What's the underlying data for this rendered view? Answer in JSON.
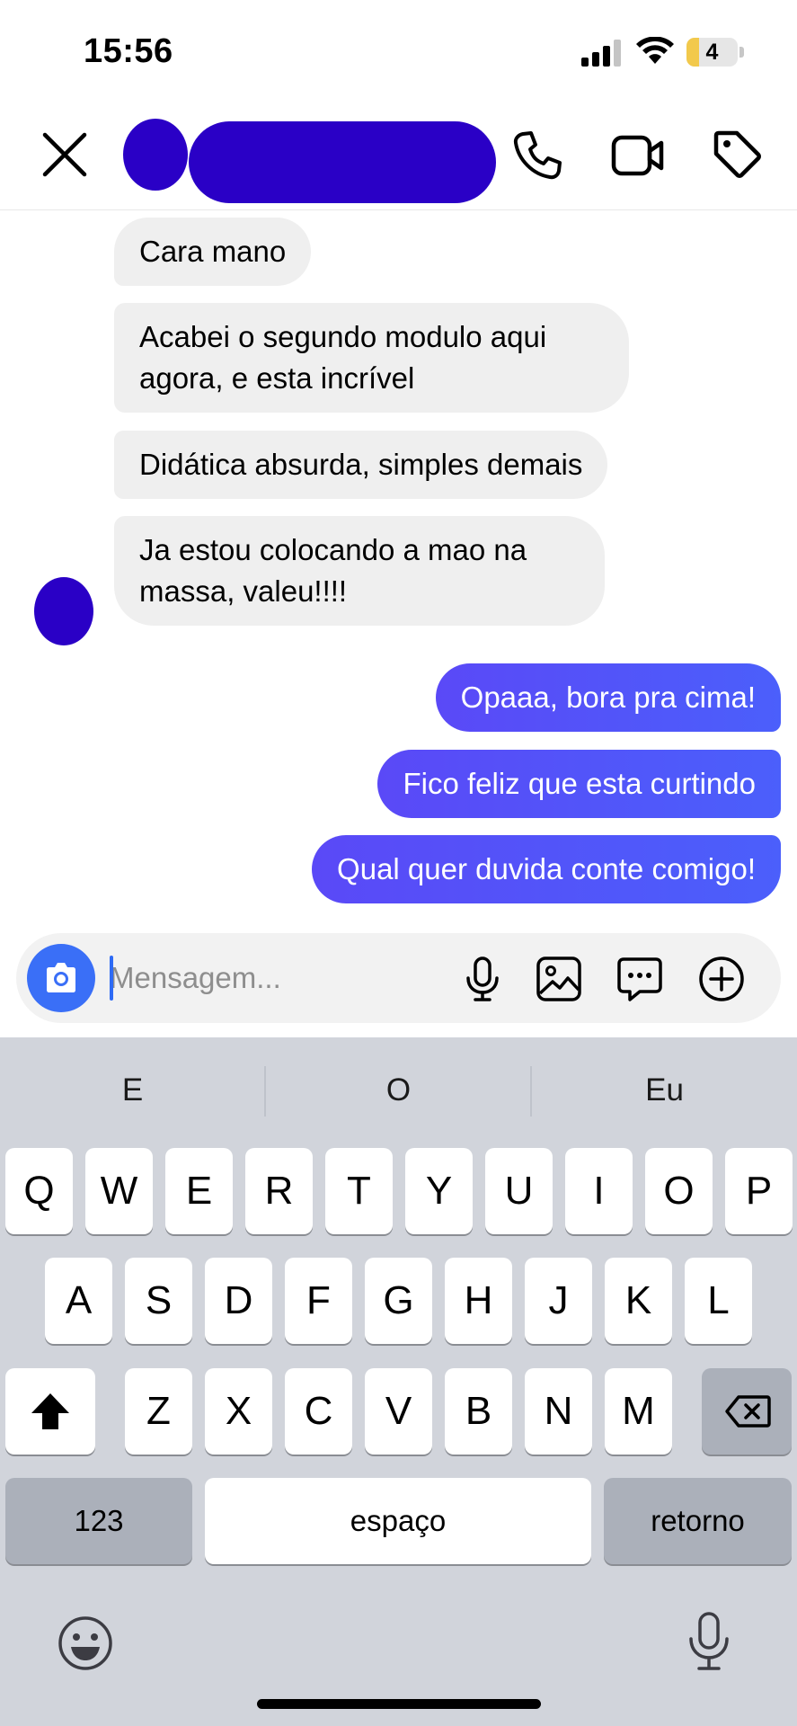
{
  "status_bar": {
    "time": "15:56",
    "battery": "4",
    "battery_level_percent": 4
  },
  "header": {
    "close_icon": "close-icon",
    "call_icon": "phone-icon",
    "video_icon": "video-camera-icon",
    "tag_icon": "tag-icon"
  },
  "messages": [
    {
      "direction": "incoming",
      "text": "Cara mano"
    },
    {
      "direction": "incoming",
      "text": "Acabei o segundo modulo aqui agora, e esta incrível"
    },
    {
      "direction": "incoming",
      "text": "Didática absurda, simples demais"
    },
    {
      "direction": "incoming",
      "text": "Ja estou colocando a mao na massa, valeu!!!!"
    },
    {
      "direction": "outgoing",
      "text": "Opaaa, bora pra cima!"
    },
    {
      "direction": "outgoing",
      "text": "Fico feliz que esta curtindo"
    },
    {
      "direction": "outgoing",
      "text": "Qual quer duvida conte comigo!"
    }
  ],
  "composer": {
    "placeholder": "Mensagem...",
    "value": ""
  },
  "keyboard": {
    "suggestions": [
      "E",
      "O",
      "Eu"
    ],
    "row1": [
      "Q",
      "W",
      "E",
      "R",
      "T",
      "Y",
      "U",
      "I",
      "O",
      "P"
    ],
    "row2": [
      "A",
      "S",
      "D",
      "F",
      "G",
      "H",
      "J",
      "K",
      "L"
    ],
    "row3": [
      "Z",
      "X",
      "C",
      "V",
      "B",
      "N",
      "M"
    ],
    "numbers_label": "123",
    "space_label": "espaço",
    "return_label": "retorno"
  },
  "colors": {
    "outgoing_bubble": "#4c5cf8",
    "incoming_bubble": "#efefef",
    "camera_button": "#3a6ff7",
    "redaction": "#2a00c6",
    "keyboard_bg": "#d1d4db"
  }
}
